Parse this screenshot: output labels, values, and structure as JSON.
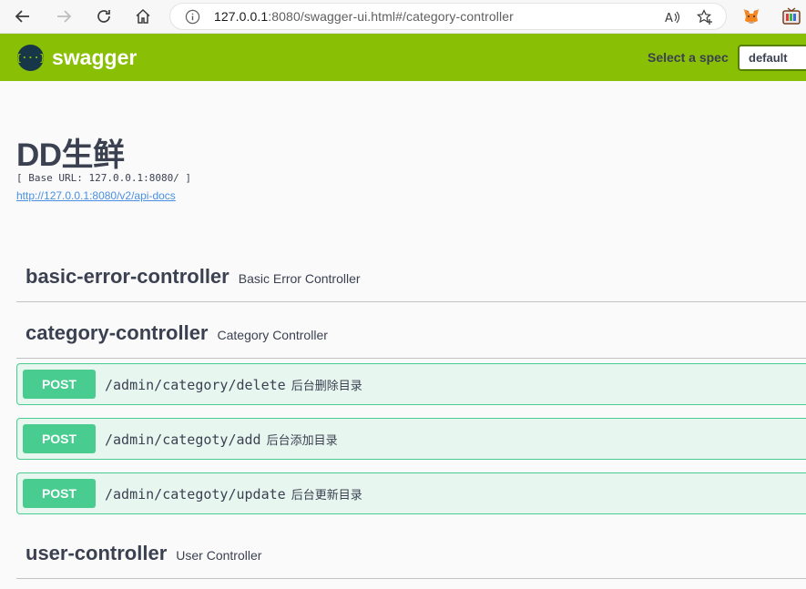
{
  "browser": {
    "url_prefix": "127.0.0.1",
    "url_rest": ":8080/swagger-ui.html#/category-controller"
  },
  "topbar": {
    "logo_glyph": "{···}",
    "logo_text": "swagger",
    "spec_label": "Select a spec",
    "spec_value": "default"
  },
  "info": {
    "title": "DD生鲜",
    "base_url": "[ Base URL: 127.0.0.1:8080/ ]",
    "docs_link": "http://127.0.0.1:8080/v2/api-docs"
  },
  "tags": [
    {
      "name": "basic-error-controller",
      "description": "Basic Error Controller"
    },
    {
      "name": "category-controller",
      "description": "Category Controller"
    },
    {
      "name": "user-controller",
      "description": "User Controller"
    }
  ],
  "operations": [
    {
      "method": "POST",
      "path": "/admin/category/delete",
      "summary": "后台删除目录"
    },
    {
      "method": "POST",
      "path": "/admin/categoty/add",
      "summary": "后台添加目录"
    },
    {
      "method": "POST",
      "path": "/admin/categoty/update",
      "summary": "后台更新目录"
    }
  ],
  "colors": {
    "topbar": "#89bf04",
    "post": "#49cc90",
    "post_bg": "#e8f6f0",
    "text": "#3b4151",
    "link": "#4990e2"
  }
}
